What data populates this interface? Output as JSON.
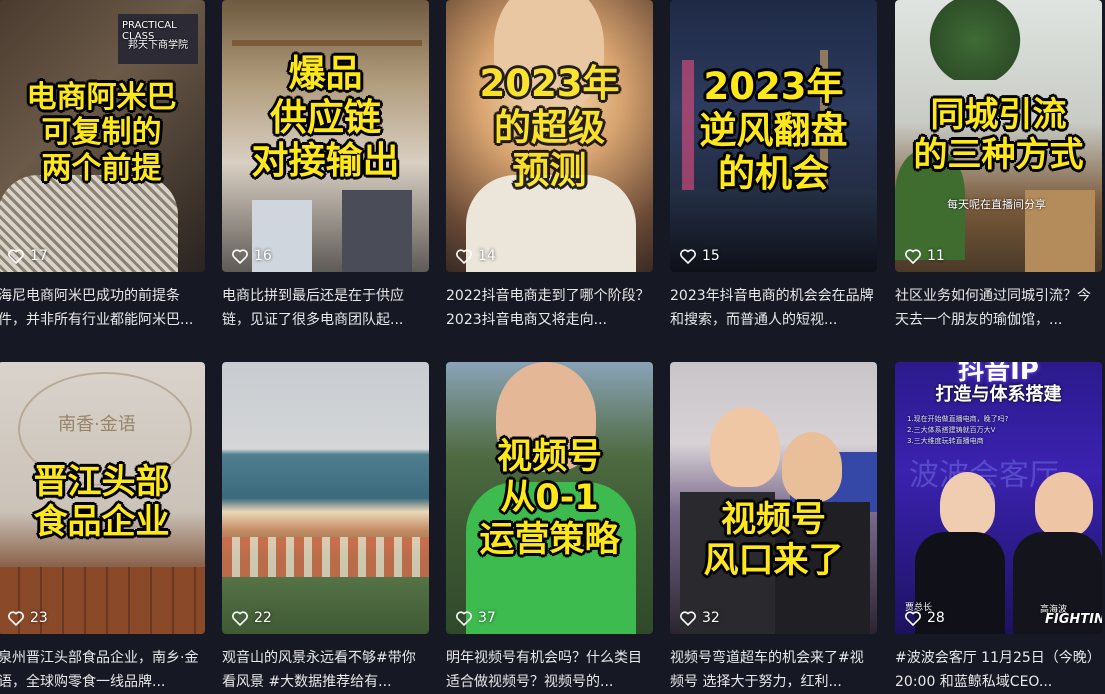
{
  "videos": [
    {
      "overlay": [
        "电商阿米巴",
        "可复制的",
        "两个前提"
      ],
      "likes": "17",
      "desc": "海尼电商阿米巴成功的前提条件，并非所有行业都能阿米巴..."
    },
    {
      "overlay": [
        "爆品",
        "供应链",
        "对接输出"
      ],
      "likes": "16",
      "desc": "电商比拼到最后还是在于供应链，见证了很多电商团队起..."
    },
    {
      "overlay": [
        "2023年",
        "的超级",
        "预测"
      ],
      "likes": "14",
      "desc": "2022抖音电商走到了哪个阶段？2023抖音电商又将走向..."
    },
    {
      "overlay": [
        "2023年",
        "逆风翻盘",
        "的机会"
      ],
      "likes": "15",
      "desc": "2023年抖音电商的机会会在品牌和搜索，而普通人的短视..."
    },
    {
      "overlay": [
        "同城引流",
        "的三种方式"
      ],
      "likes": "11",
      "desc": "社区业务如何通过同城引流？今天去一个朋友的瑜伽馆，..."
    },
    {
      "overlay": [
        "晋江头部",
        "食品企业"
      ],
      "likes": "23",
      "desc": "泉州晋江头部食品企业，南乡·金语，全球购零食一线品牌..."
    },
    {
      "overlay": [],
      "likes": "22",
      "desc": "观音山的风景永远看不够#带你看风景 #大数据推荐给有..."
    },
    {
      "overlay": [
        "视频号",
        "从0-1",
        "运营策略"
      ],
      "likes": "37",
      "desc": "明年视频号有机会吗？什么类目适合做视频号？视频号的..."
    },
    {
      "overlay": [
        "视频号",
        "风口来了"
      ],
      "likes": "32",
      "desc": "视频号弯道超车的机会来了#视频号 选择大于努力，红利..."
    },
    {
      "overlay": [],
      "likes": "28",
      "desc": "#波波会客厅 11月25日（今晚）20:00 和蓝鲸私域CEO..."
    }
  ],
  "extras": {
    "class_sign_1": "PRACTICAL CLASS",
    "class_sign_2": "邦天下商学院",
    "live_caption": "每天呢在直播间分享",
    "wall_text": "南香·金语",
    "poster_title_1": "抖音IP",
    "poster_title_2": "打造与体系搭建",
    "poster_items": [
      "1.现在开始做直播电商，晚了吗?",
      "2.三大体系搭建铸就百万大V",
      "3.三大维度玩转直播电商"
    ],
    "poster_bg_text": "波波会客厅",
    "guest_left": "贾总长",
    "guest_right": "高海波",
    "fighting": "FIGHTING!"
  },
  "colors": {
    "background": "#161823",
    "overlay_text": "#ffe81a",
    "desc_text": "#e8e8ea"
  }
}
